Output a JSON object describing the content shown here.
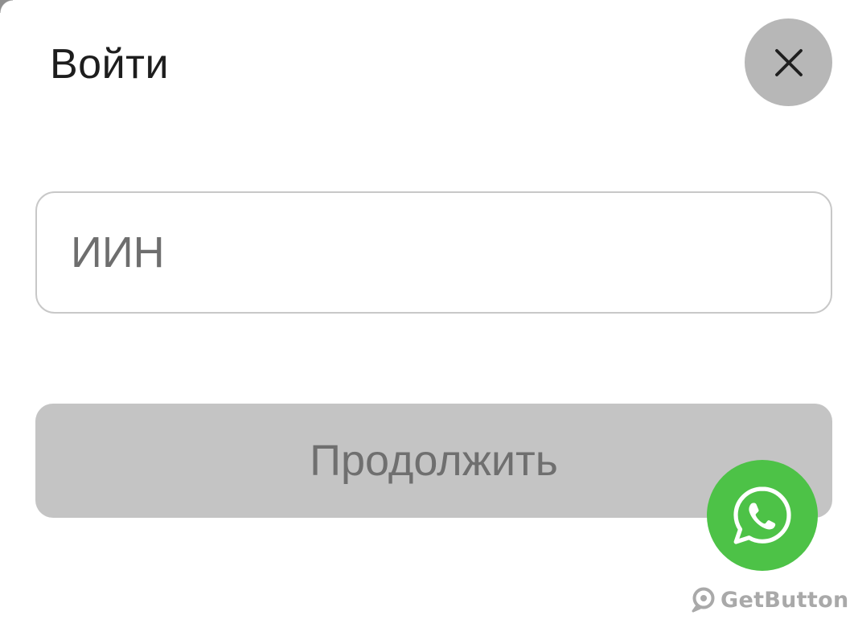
{
  "modal": {
    "title": "Войти",
    "close_icon": "close-icon",
    "iin_input": {
      "placeholder": "ИИН",
      "value": ""
    },
    "continue_label": "Продолжить"
  },
  "widget": {
    "whatsapp_icon": "whatsapp-icon",
    "brand_label": "GetButton",
    "brand_icon": "getbutton-logo-icon"
  },
  "colors": {
    "close_bg": "#b7b7b7",
    "input_border": "#c8c8c8",
    "continue_bg": "#c4c4c4",
    "continue_text": "#6f6f6f",
    "whatsapp_green": "#4dc247",
    "brand_text": "#a9a9a9"
  }
}
